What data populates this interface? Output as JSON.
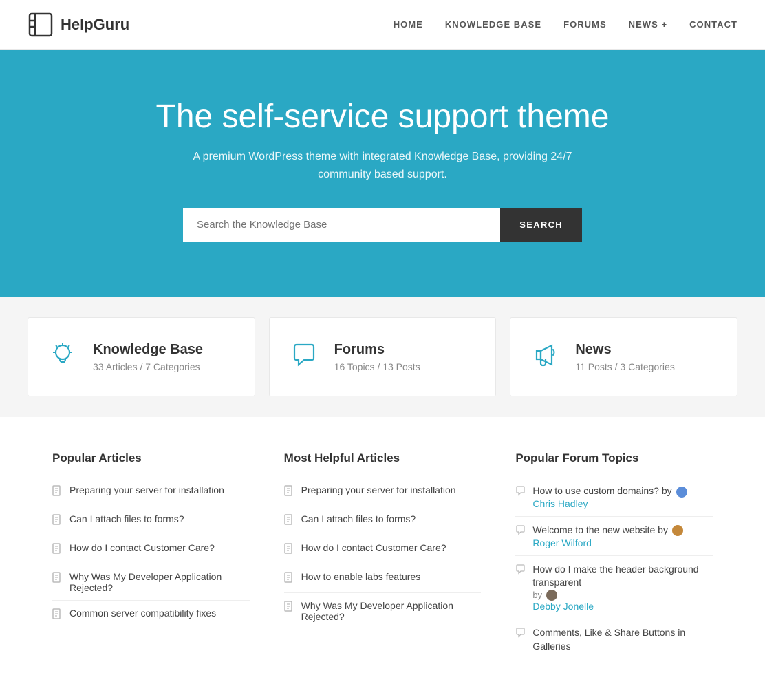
{
  "header": {
    "logo_text": "HelpGuru",
    "nav": [
      {
        "label": "HOME",
        "id": "home"
      },
      {
        "label": "KNOWLEDGE BASE",
        "id": "knowledge-base"
      },
      {
        "label": "FORUMS",
        "id": "forums"
      },
      {
        "label": "NEWS +",
        "id": "news"
      },
      {
        "label": "CONTACT",
        "id": "contact"
      }
    ]
  },
  "hero": {
    "title": "The self-service support theme",
    "subtitle": "A premium WordPress theme with integrated Knowledge Base, providing 24/7 community based support.",
    "search_placeholder": "Search the Knowledge Base",
    "search_button": "SEARCH"
  },
  "stats": [
    {
      "id": "knowledge-base",
      "icon": "lightbulb",
      "title": "Knowledge Base",
      "sub": "33 Articles / 7 Categories"
    },
    {
      "id": "forums",
      "icon": "chat",
      "title": "Forums",
      "sub": "16 Topics / 13 Posts"
    },
    {
      "id": "news",
      "icon": "megaphone",
      "title": "News",
      "sub": "11 Posts / 3 Categories"
    }
  ],
  "popular_articles": {
    "title": "Popular Articles",
    "items": [
      "Preparing your server for installation",
      "Can I attach files to forms?",
      "How do I contact Customer Care?",
      "Why Was My Developer Application Rejected?",
      "Common server compatibility fixes"
    ]
  },
  "helpful_articles": {
    "title": "Most Helpful Articles",
    "items": [
      "Preparing your server for installation",
      "Can I attach files to forms?",
      "How do I contact Customer Care?",
      "How to enable labs features",
      "Why Was My Developer Application Rejected?"
    ]
  },
  "forum_topics": {
    "title": "Popular Forum Topics",
    "items": [
      {
        "topic": "How to use custom domains?",
        "by": "by",
        "author": "Chris Hadley",
        "avatar_class": "avatar-blue"
      },
      {
        "topic": "Welcome to the new website",
        "by": "by",
        "author": "Roger Wilford",
        "avatar_class": "avatar-brown"
      },
      {
        "topic": "How do I make the header background transparent",
        "by": "by",
        "author": "Debby Jonelle",
        "avatar_class": "avatar-dark"
      },
      {
        "topic": "Comments, Like & Share Buttons in Galleries",
        "by": "",
        "author": "",
        "avatar_class": ""
      }
    ]
  }
}
